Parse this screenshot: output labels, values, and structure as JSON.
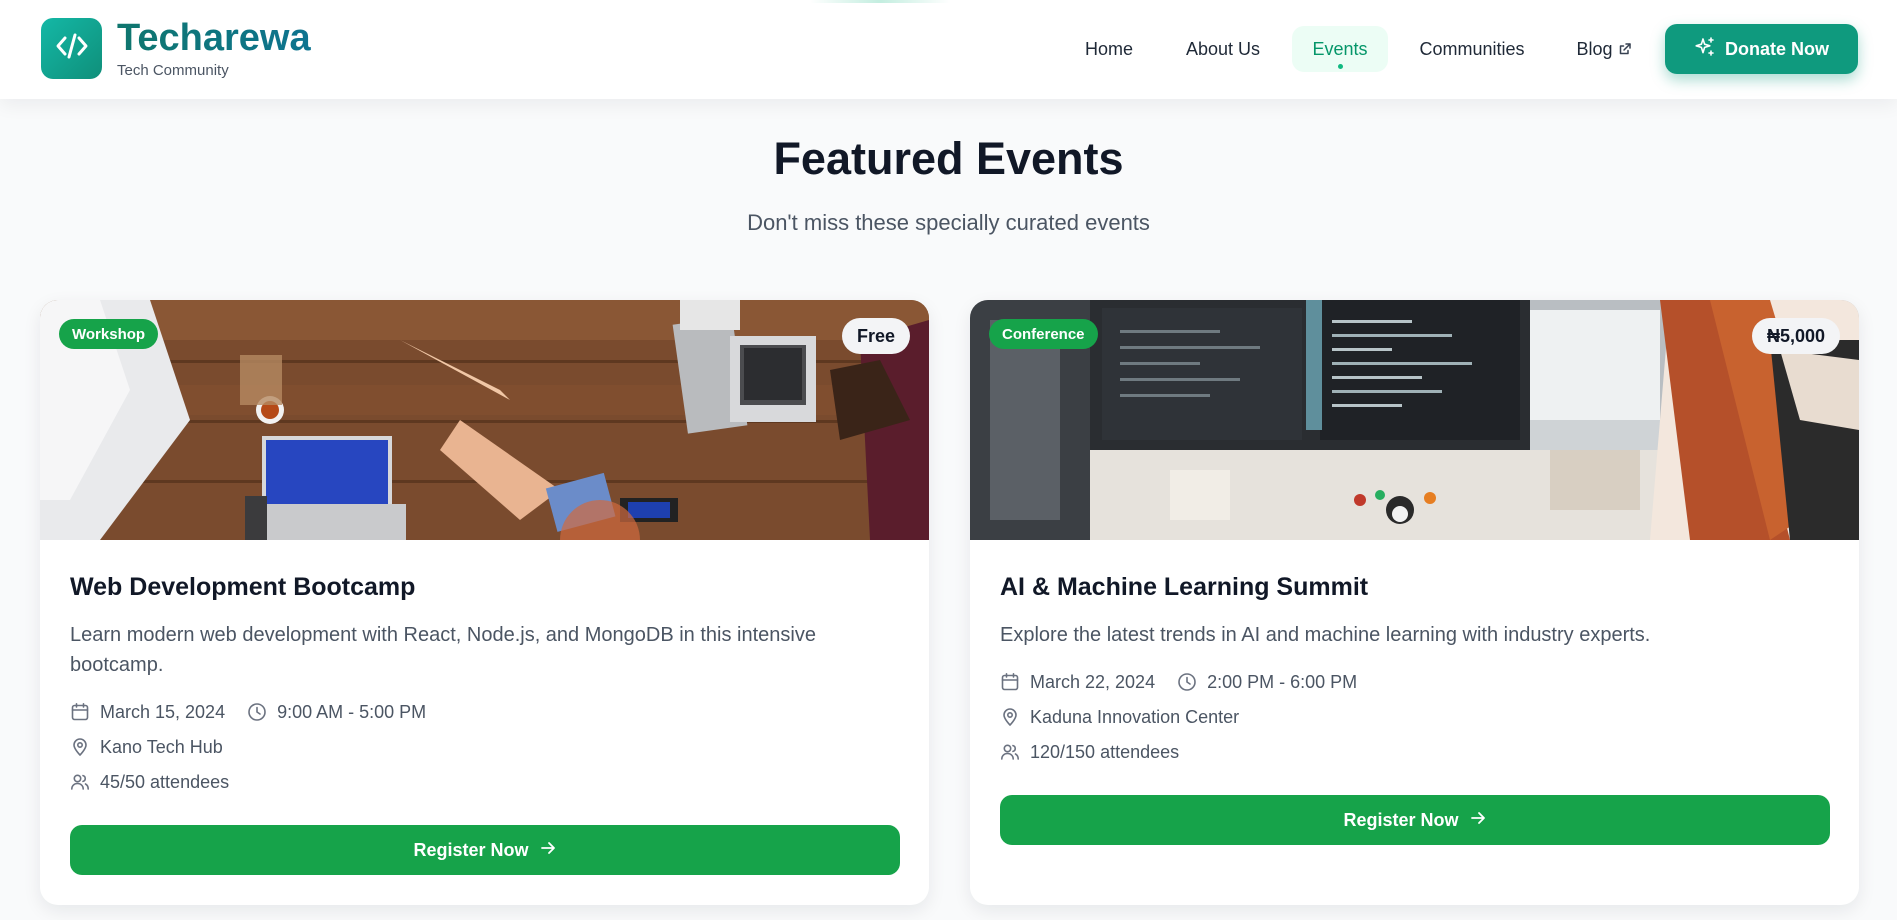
{
  "brand": {
    "name": "Techarewa",
    "tagline": "Tech Community",
    "logo_icon": "code-icon"
  },
  "nav": {
    "items": [
      {
        "label": "Home"
      },
      {
        "label": "About Us"
      },
      {
        "label": "Events",
        "active": true
      },
      {
        "label": "Communities"
      },
      {
        "label": "Blog",
        "external": true
      }
    ],
    "donate_label": "Donate Now",
    "donate_icon": "sparkles-icon"
  },
  "section": {
    "title": "Featured Events",
    "subtitle": "Don't miss these specially curated events"
  },
  "events": [
    {
      "category": "Workshop",
      "price": "Free",
      "title": "Web Development Bootcamp",
      "description": "Learn modern web development with React, Node.js, and MongoDB in this intensive bootcamp.",
      "date": "March 15, 2024",
      "time": "9:00 AM - 5:00 PM",
      "location": "Kano Tech Hub",
      "attendees": "45/50 attendees",
      "cta": "Register Now"
    },
    {
      "category": "Conference",
      "price": "₦5,000",
      "title": "AI & Machine Learning Summit",
      "description": "Explore the latest trends in AI and machine learning with industry experts.",
      "date": "March 22, 2024",
      "time": "2:00 PM - 6:00 PM",
      "location": "Kaduna Innovation Center",
      "attendees": "120/150 attendees",
      "cta": "Register Now"
    }
  ],
  "colors": {
    "brand": "#0f766e",
    "accent": "#16a34a",
    "donate": "#0f9a7e"
  }
}
